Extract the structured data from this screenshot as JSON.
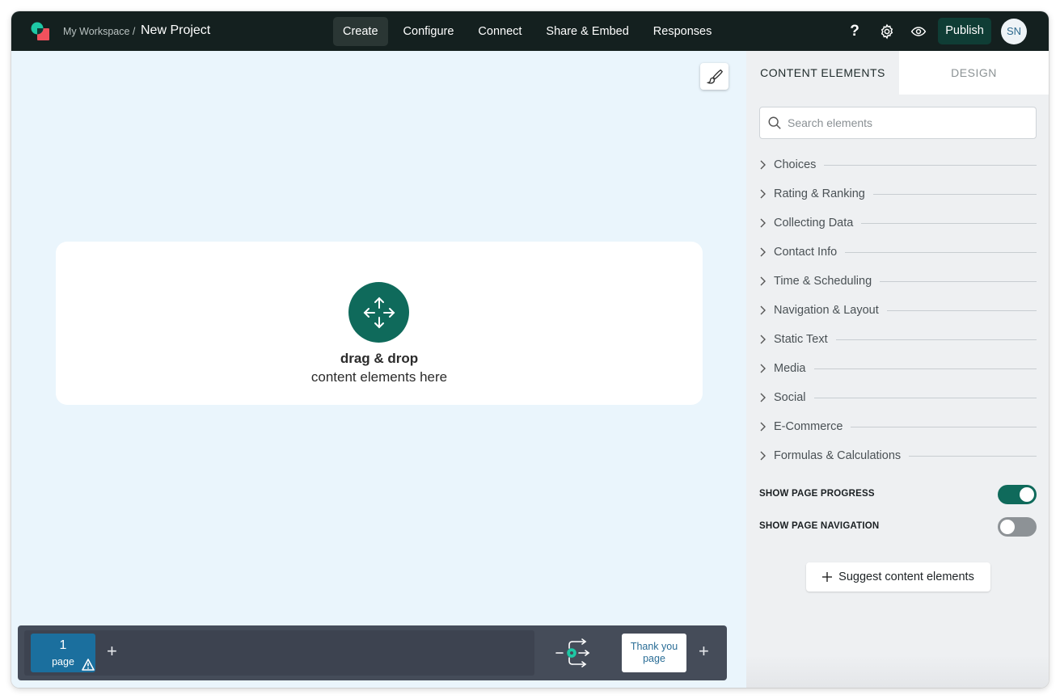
{
  "header": {
    "workspace": "My Workspace /",
    "project": "New Project",
    "nav": [
      "Create",
      "Configure",
      "Connect",
      "Share & Embed",
      "Responses"
    ],
    "help": "?",
    "publish": "Publish",
    "avatar": "SN"
  },
  "canvas": {
    "drop_title": "drag & drop",
    "drop_subtitle": "content elements here"
  },
  "pagebar": {
    "page_number": "1",
    "page_label": "page",
    "add": "+",
    "thanks_line1": "Thank you",
    "thanks_line2": "page"
  },
  "panel": {
    "tabs": [
      "CONTENT ELEMENTS",
      "DESIGN"
    ],
    "search_placeholder": "Search elements",
    "categories": [
      "Choices",
      "Rating & Ranking",
      "Collecting Data",
      "Contact Info",
      "Time & Scheduling",
      "Navigation & Layout",
      "Static Text",
      "Media",
      "Social",
      "E-Commerce",
      "Formulas & Calculations"
    ],
    "show_progress": {
      "label": "SHOW PAGE PROGRESS",
      "on": true
    },
    "show_navigation": {
      "label": "SHOW PAGE NAVIGATION",
      "on": false
    },
    "suggest": "Suggest content elements"
  },
  "colors": {
    "topbar": "#14201f",
    "accent_green": "#0f6a5b",
    "page_blue": "#1b6f9e",
    "canvas_bg": "#eaf5fc"
  },
  "icons": [
    "logo-icon",
    "help-icon",
    "gear-icon",
    "eye-icon",
    "brush-icon",
    "move-arrows-icon",
    "warning-icon",
    "logic-flow-icon",
    "search-icon",
    "chevron-right-icon",
    "plus-icon"
  ]
}
